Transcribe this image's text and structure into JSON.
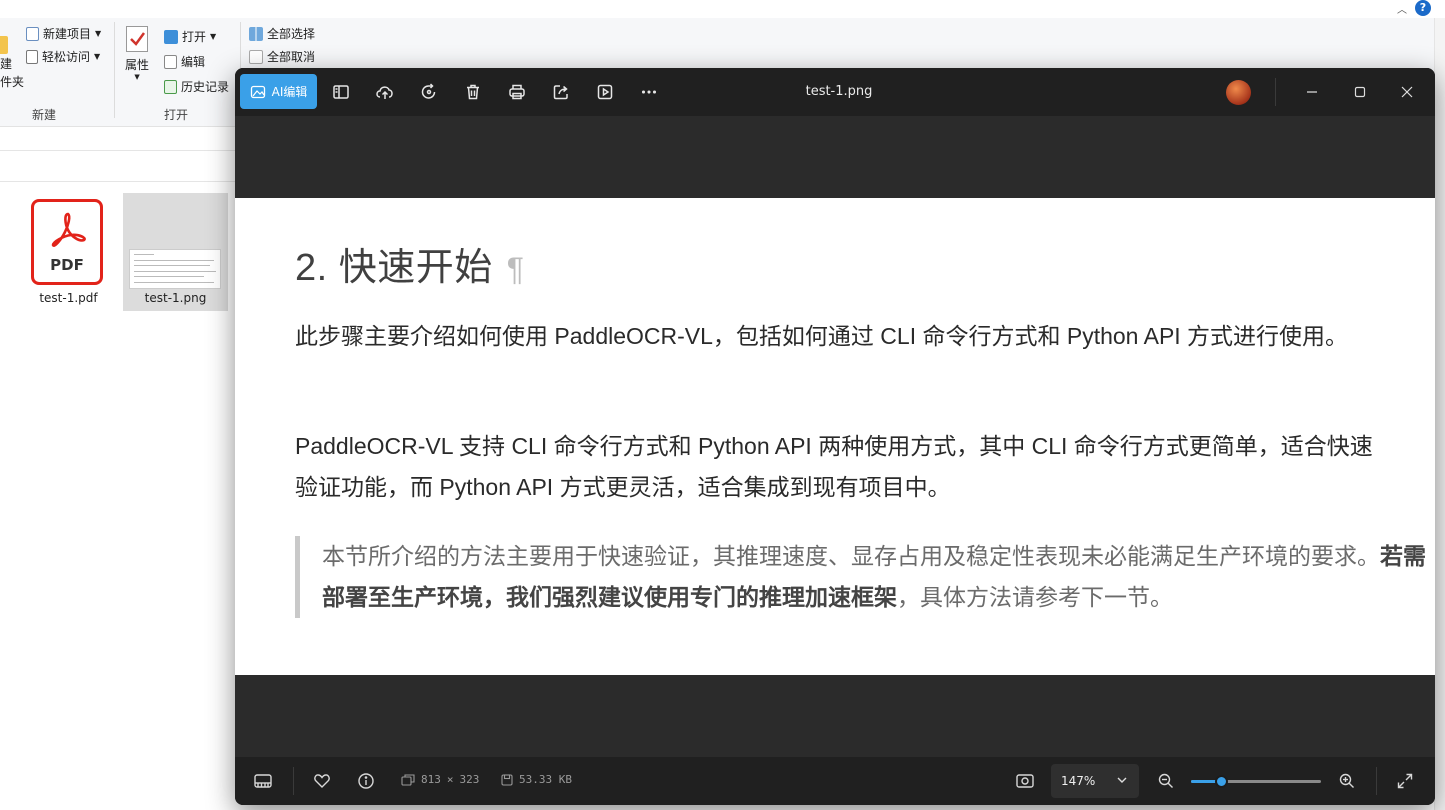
{
  "explorer": {
    "ribbon": {
      "new_group": {
        "new_item_label": "新建项目",
        "easy_access_label": "轻松访问",
        "new_folder_line1": "建",
        "new_folder_line2": "件夹",
        "group_label": "新建"
      },
      "open_group": {
        "properties_label": "属性",
        "open_label": "打开",
        "edit_label": "编辑",
        "history_label": "历史记录",
        "group_label": "打开"
      },
      "select_group": {
        "select_all_label": "全部选择",
        "select_none_label": "全部取消"
      }
    },
    "files": [
      {
        "name": "test-1.pdf",
        "icon": "pdf-icon",
        "icon_text": "PDF"
      },
      {
        "name": "test-1.png",
        "icon": "image-thumbnail"
      }
    ]
  },
  "viewer": {
    "title": "test-1.png",
    "ai_edit_label": "AI编辑",
    "accent_color": "#3aa0e8",
    "toolbar_icons": [
      "sidebar-icon",
      "upload-cloud-icon",
      "rotate-icon",
      "delete-icon",
      "print-icon",
      "share-icon",
      "slideshow-icon",
      "more-icon"
    ],
    "document": {
      "heading": "2. 快速开始",
      "pilcrow": "¶",
      "para1": "此步骤主要介绍如何使用 PaddleOCR-VL，包括如何通过 CLI 命令行方式和 Python API 方式进行使用。",
      "para2": "PaddleOCR-VL 支持 CLI 命令行方式和 Python API 两种使用方式，其中 CLI 命令行方式更简单，适合快速验证功能，而 Python API 方式更灵活，适合集成到现有项目中。",
      "quote_normal": "本节所介绍的方法主要用于快速验证，其推理速度、显存占用及稳定性表现未必能满足生产环境的要求。",
      "quote_bold": "若需部署至生产环境，我们强烈建议使用专门的推理加速框架",
      "quote_tail": "，具体方法请参考下一节。"
    },
    "bottom_bar": {
      "dimensions_w": "813",
      "dimensions_x": "×",
      "dimensions_h": "323",
      "file_size": "53.33 KB",
      "zoom_label": "147%",
      "zoom_fraction": 0.23
    }
  }
}
